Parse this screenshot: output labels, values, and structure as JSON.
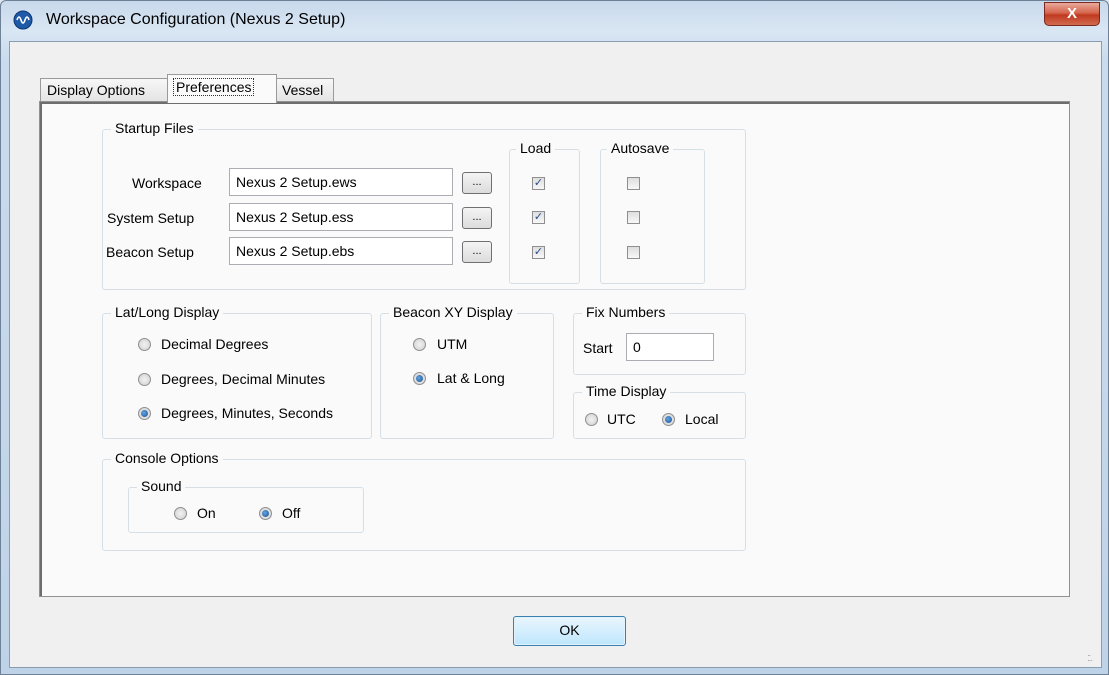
{
  "window": {
    "title": "Workspace Configuration (Nexus 2 Setup)",
    "close_label": "X"
  },
  "tabs": [
    {
      "label": "Display Options"
    },
    {
      "label": "Preferences",
      "active": true
    },
    {
      "label": "Vessel"
    }
  ],
  "startup": {
    "group": "Startup Files",
    "load_label": "Load",
    "autosave_label": "Autosave",
    "browse_label": "...",
    "rows": [
      {
        "label": "Workspace",
        "file": "Nexus 2 Setup.ews",
        "load": true,
        "autosave": false
      },
      {
        "label": "System Setup",
        "file": "Nexus 2 Setup.ess",
        "load": true,
        "autosave": false
      },
      {
        "label": "Beacon Setup",
        "file": "Nexus 2 Setup.ebs",
        "load": true,
        "autosave": false
      }
    ]
  },
  "latlong": {
    "group": "Lat/Long Display",
    "options": [
      "Decimal Degrees",
      "Degrees, Decimal Minutes",
      "Degrees, Minutes, Seconds"
    ],
    "selected": "Degrees, Minutes, Seconds"
  },
  "beacon_xy": {
    "group": "Beacon XY Display",
    "options": [
      "UTM",
      "Lat & Long"
    ],
    "selected": "Lat & Long"
  },
  "fix_numbers": {
    "group": "Fix Numbers",
    "start_label": "Start",
    "start_value": "0"
  },
  "time_display": {
    "group": "Time Display",
    "options": [
      "UTC",
      "Local"
    ],
    "selected": "Local"
  },
  "console": {
    "group": "Console Options",
    "sound_group": "Sound",
    "options": [
      "On",
      "Off"
    ],
    "selected": "Off"
  },
  "ok_label": "OK",
  "colors": {
    "title_glass": "#c8d9ec",
    "close_red": "#c0391f",
    "panel": "#fafafa",
    "ok_blue": "#bee6fd"
  }
}
